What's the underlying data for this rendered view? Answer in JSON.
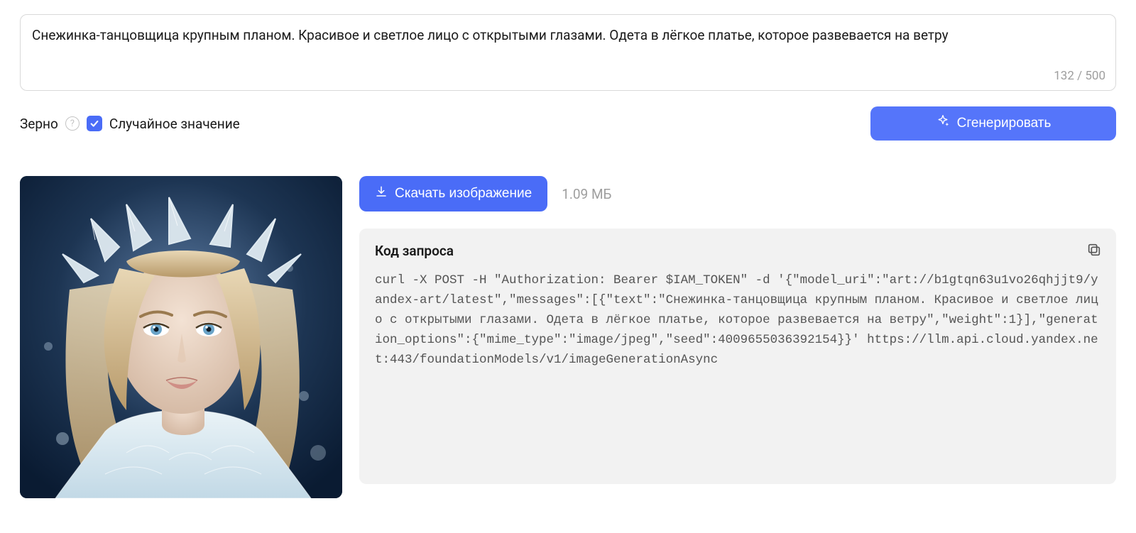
{
  "prompt": {
    "text": "Снежинка-танцовщица крупным планом. Красивое и светлое лицо с открытыми глазами. Одета в лёгкое платье, которое развевается на ветру",
    "char_count": "132 / 500"
  },
  "seed": {
    "label": "Зерно",
    "checkbox_label": "Случайное значение",
    "checked": true
  },
  "actions": {
    "generate_label": "Сгенерировать",
    "download_label": "Скачать изображение",
    "file_size": "1.09 МБ"
  },
  "code": {
    "title": "Код запроса",
    "content": "curl -X POST -H \"Authorization: Bearer $IAM_TOKEN\" -d '{\"model_uri\":\"art://b1gtqn63u1vo26qhjjt9/yandex-art/latest\",\"messages\":[{\"text\":\"Снежинка-танцовщица крупным планом. Красивое и светлое лицо с открытыми глазами. Одета в лёгкое платье, которое развевается на ветру\",\"weight\":1}],\"generation_options\":{\"mime_type\":\"image/jpeg\",\"seed\":4009655036392154}}' https://llm.api.cloud.yandex.net:443/foundationModels/v1/imageGenerationAsync"
  }
}
